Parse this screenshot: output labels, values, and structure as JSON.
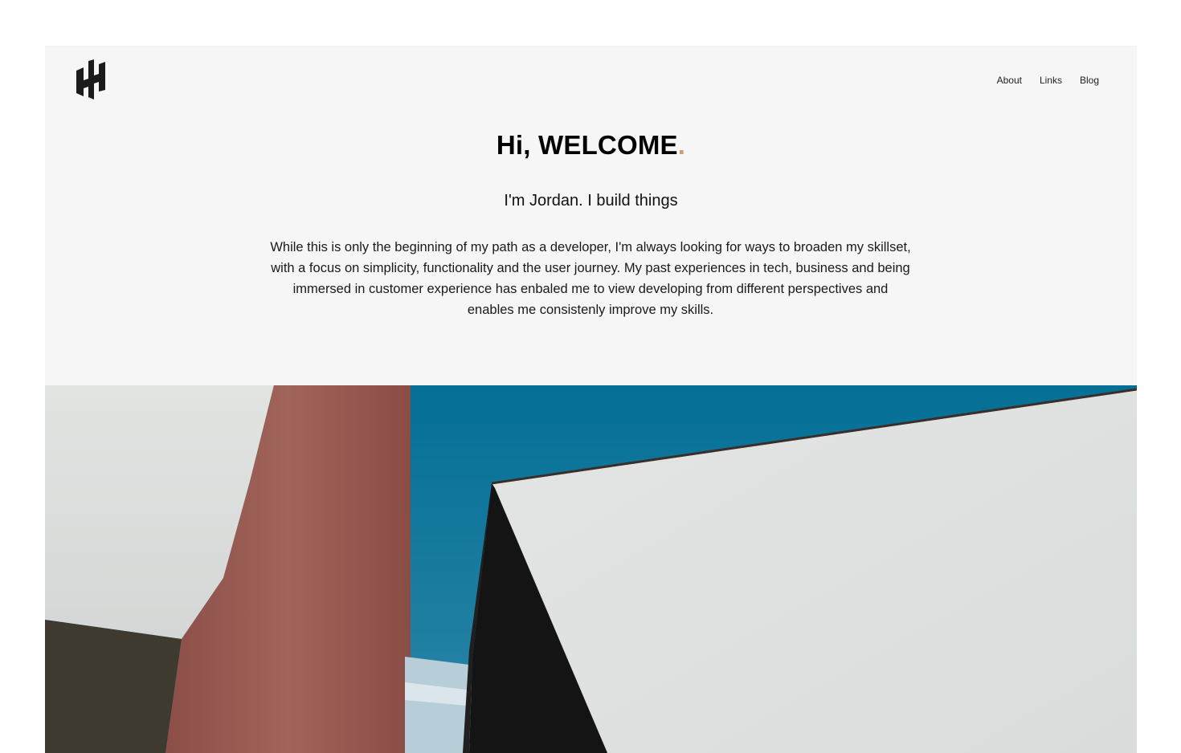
{
  "header": {
    "logo_icon": "hh-monogram-logo",
    "nav": [
      {
        "label": "About"
      },
      {
        "label": "Links"
      },
      {
        "label": "Blog"
      }
    ]
  },
  "hero": {
    "title": "Hi, WELCOME",
    "title_dot": ".",
    "tagline": "I'm Jordan. I build things",
    "intro": "While this is only the beginning of my path as a developer, I'm always looking for ways to broaden my skillset, with a focus on simplicity, functionality and the user journey. My past experiences in tech, business and being immersed in customer experience has enbaled me to view developing from different perspectives and enables me consistenly improve my skills."
  },
  "colors": {
    "background": "#f6f6f6",
    "accent_dot": "#c8a27d",
    "sky": "#0a6f96",
    "terracotta": "#9a5a52",
    "wall_light": "#dfe2e1",
    "shadow_dark": "#151515"
  },
  "image": {
    "name": "architecture-hero-image"
  }
}
